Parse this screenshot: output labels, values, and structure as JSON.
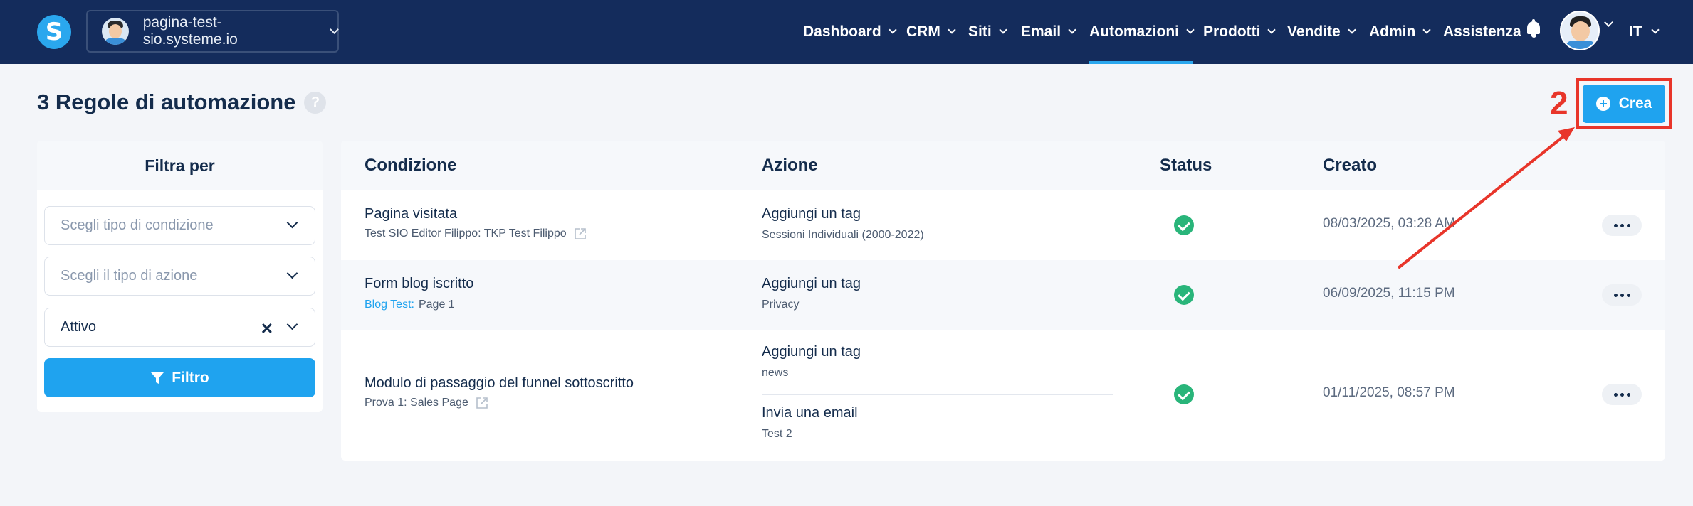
{
  "navbar": {
    "logo_letter": "S",
    "site_selector": {
      "label": "pagina-test-sio.systeme.io"
    },
    "menu": [
      {
        "label": "Dashboard",
        "active": false
      },
      {
        "label": "CRM",
        "active": false
      },
      {
        "label": "Siti",
        "active": false
      },
      {
        "label": "Email",
        "active": false
      },
      {
        "label": "Automazioni",
        "active": true
      },
      {
        "label": "Prodotti",
        "active": false
      },
      {
        "label": "Vendite",
        "active": false
      },
      {
        "label": "Admin",
        "active": false
      }
    ],
    "support_label": "Assistenza",
    "language": "IT"
  },
  "header": {
    "title": "3 Regole di automazione",
    "help_icon": "?",
    "create_label": "Crea",
    "annotation_step": "2"
  },
  "filter": {
    "title": "Filtra per",
    "condition_placeholder": "Scegli tipo di condizione",
    "action_placeholder": "Scegli il tipo di azione",
    "status_value": "Attivo",
    "clear_icon": "✕",
    "filter_button": "Filtro"
  },
  "table": {
    "headers": {
      "condition": "Condizione",
      "action": "Azione",
      "status": "Status",
      "created": "Creato"
    },
    "rows": [
      {
        "condition_title": "Pagina visitata",
        "condition_sub": "Test SIO Editor Filippo: TKP Test Filippo",
        "actions": [
          {
            "title": "Aggiungi un tag",
            "sub": "Sessioni Individuali (2000-2022)"
          }
        ],
        "created": "08/03/2025, 03:28 AM"
      },
      {
        "condition_title": "Form blog iscritto",
        "condition_link": "Blog Test:",
        "condition_sub": "Page 1",
        "actions": [
          {
            "title": "Aggiungi un tag",
            "sub": "Privacy"
          }
        ],
        "created": "06/09/2025, 11:15 PM"
      },
      {
        "condition_title": "Modulo di passaggio del funnel sottoscritto",
        "condition_sub": "Prova 1: Sales Page",
        "actions": [
          {
            "title": "Aggiungi un tag",
            "sub": "news"
          },
          {
            "title": "Invia una email",
            "sub": "Test 2"
          }
        ],
        "created": "01/11/2025, 08:57 PM"
      }
    ]
  },
  "colors": {
    "navbar": "#142c5c",
    "accent": "#1fa3ef",
    "success": "#29b57a",
    "annotation": "#e8352a"
  }
}
